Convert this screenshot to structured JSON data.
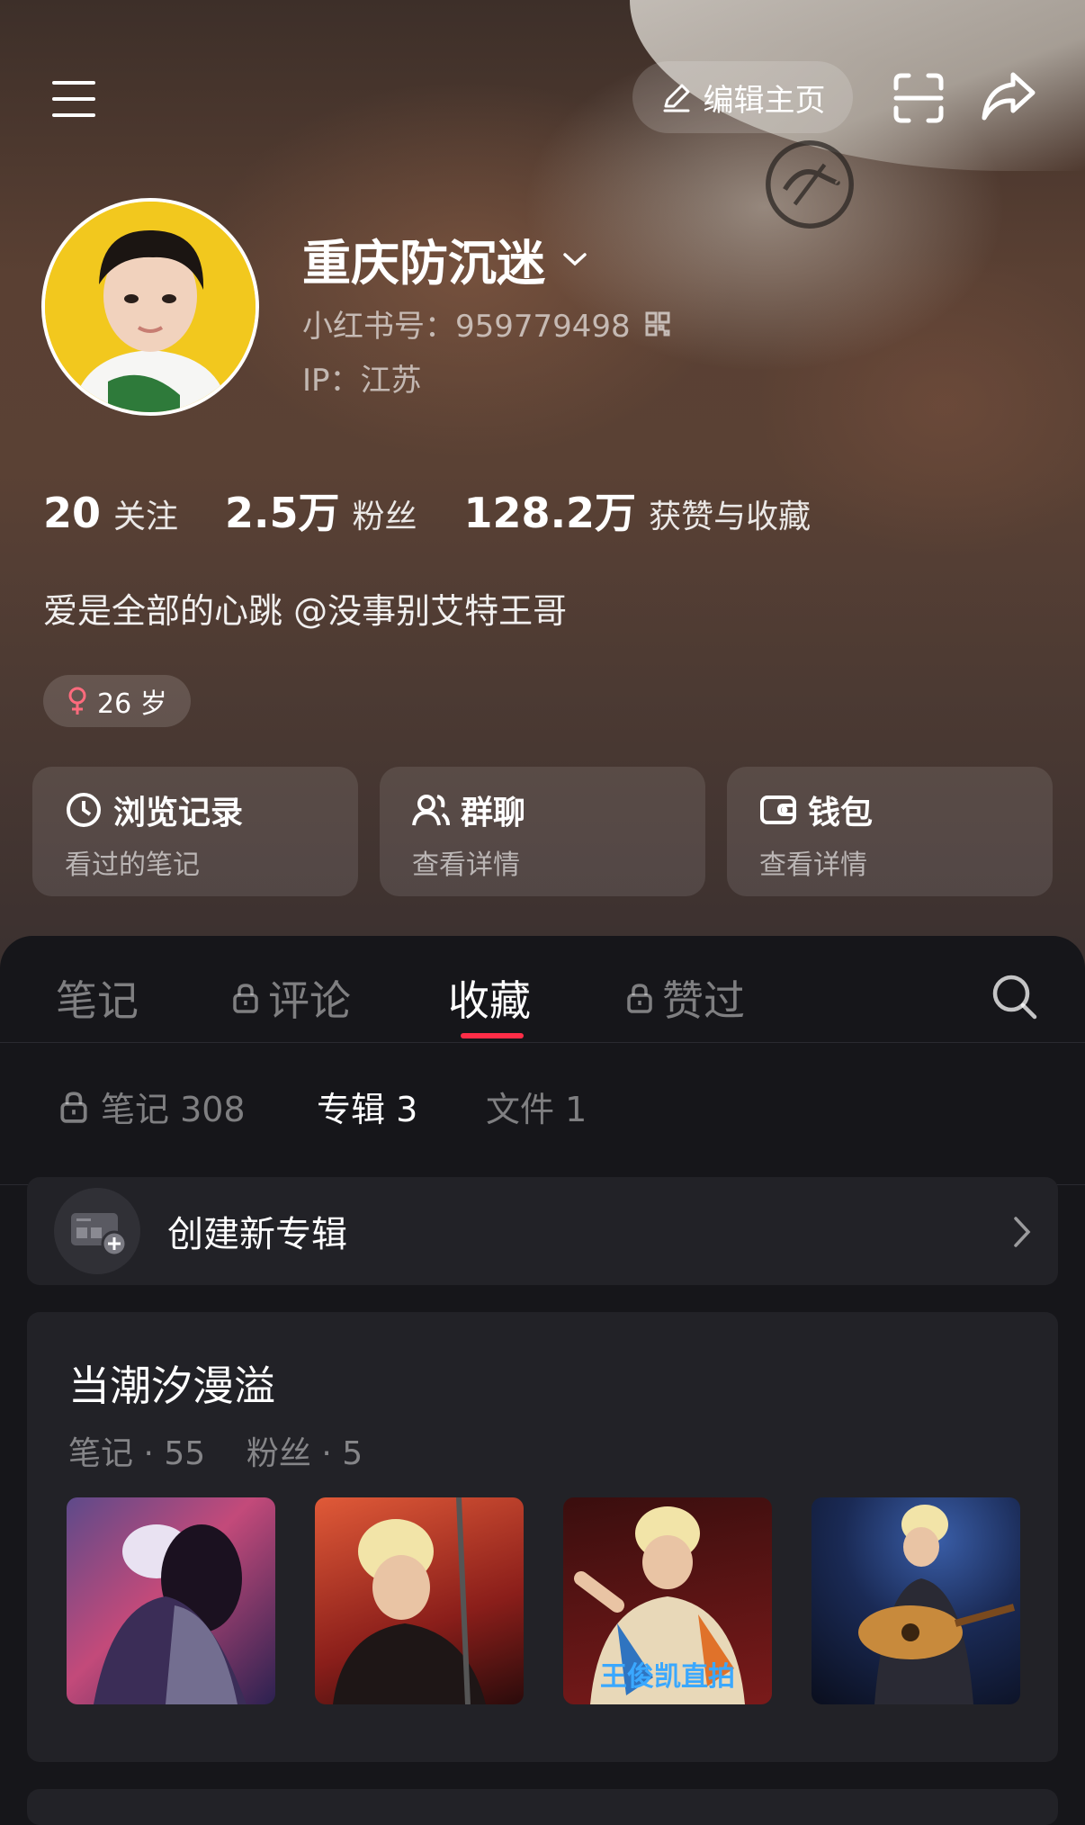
{
  "topbar": {
    "edit_label": "编辑主页"
  },
  "profile": {
    "username": "重庆防沉迷",
    "uid_text": "小红书号：959779498",
    "ip_text": "IP：江苏",
    "stats": [
      {
        "num": "20",
        "label": "关注"
      },
      {
        "num": "2.5万",
        "label": "粉丝"
      },
      {
        "num": "128.2万",
        "label": "获赞与收藏"
      }
    ],
    "bio": "爱是全部的心跳 @没事别艾特王哥",
    "tag": "26 岁"
  },
  "cards": [
    {
      "title": "浏览记录",
      "sub": "看过的笔记",
      "icon": "clock-icon"
    },
    {
      "title": "群聊",
      "sub": "查看详情",
      "icon": "group-icon"
    },
    {
      "title": "钱包",
      "sub": "查看详情",
      "icon": "wallet-icon"
    }
  ],
  "tabs": [
    {
      "label": "笔记",
      "locked": false
    },
    {
      "label": "评论",
      "locked": true
    },
    {
      "label": "收藏",
      "locked": false,
      "active": true
    },
    {
      "label": "赞过",
      "locked": true
    }
  ],
  "subtabs": [
    {
      "label": "笔记 308",
      "locked": true
    },
    {
      "label": "专辑 3",
      "active": true
    },
    {
      "label": "文件 1"
    }
  ],
  "create_album": {
    "label": "创建新专辑"
  },
  "album": {
    "title": "当潮汐漫溢",
    "meta": "笔记 · 55    粉丝 · 5",
    "thumb_captions": [
      "",
      "",
      "王俊凯直拍",
      ""
    ]
  },
  "colors": {
    "accent": "#ff2d47",
    "panel": "#16161a",
    "card": "#222227"
  }
}
